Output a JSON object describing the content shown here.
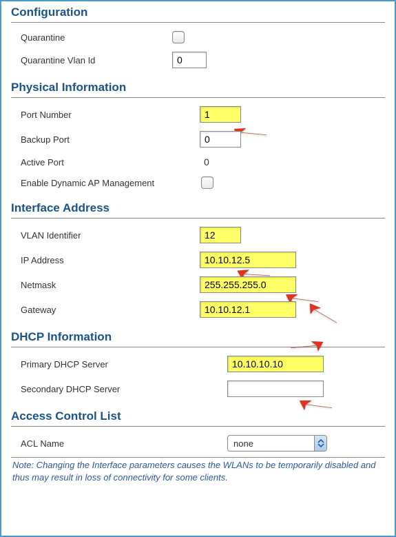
{
  "configuration": {
    "header": "Configuration",
    "quarantine_label": "Quarantine",
    "quarantine_checked": false,
    "quarantine_vlan_label": "Quarantine Vlan Id",
    "quarantine_vlan_value": "0"
  },
  "physical": {
    "header": "Physical Information",
    "port_number_label": "Port Number",
    "port_number_value": "1",
    "backup_port_label": "Backup Port",
    "backup_port_value": "0",
    "active_port_label": "Active Port",
    "active_port_value": "0",
    "dyn_ap_label": "Enable Dynamic AP Management",
    "dyn_ap_checked": false
  },
  "interface": {
    "header": "Interface Address",
    "vlan_label": "VLAN Identifier",
    "vlan_value": "12",
    "ip_label": "IP Address",
    "ip_value": "10.10.12.5",
    "netmask_label": "Netmask",
    "netmask_value": "255.255.255.0",
    "gateway_label": "Gateway",
    "gateway_value": "10.10.12.1"
  },
  "dhcp": {
    "header": "DHCP Information",
    "primary_label": "Primary DHCP Server",
    "primary_value": "10.10.10.10",
    "secondary_label": "Secondary DHCP Server",
    "secondary_value": ""
  },
  "acl": {
    "header": "Access Control List",
    "name_label": "ACL Name",
    "name_value": "none"
  },
  "note": "Note: Changing the Interface parameters causes the WLANs to be temporarily disabled and thus may result in loss of connectivity for some clients."
}
